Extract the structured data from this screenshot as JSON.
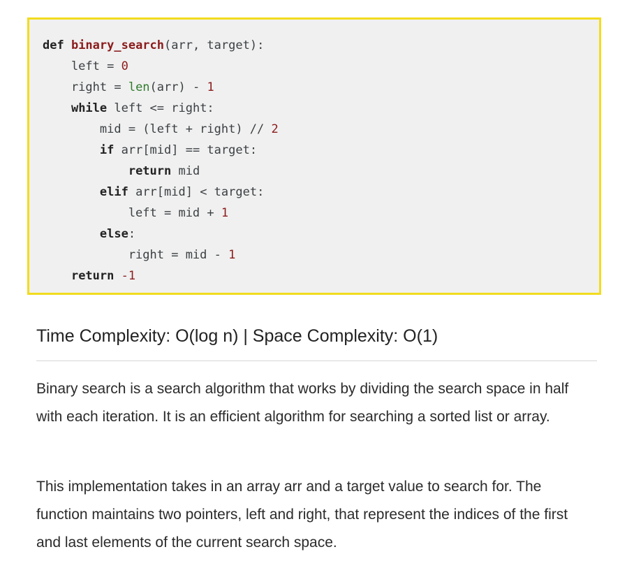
{
  "code": {
    "language": "python",
    "lines": [
      [
        {
          "t": "kw",
          "v": "def "
        },
        {
          "t": "fn",
          "v": "binary_search"
        },
        {
          "t": "p",
          "v": "(arr, target):"
        }
      ],
      [
        {
          "t": "p",
          "v": "    left = "
        },
        {
          "t": "num",
          "v": "0"
        }
      ],
      [
        {
          "t": "p",
          "v": "    right = "
        },
        {
          "t": "bi",
          "v": "len"
        },
        {
          "t": "p",
          "v": "(arr) - "
        },
        {
          "t": "num",
          "v": "1"
        }
      ],
      [
        {
          "t": "p",
          "v": "    "
        },
        {
          "t": "kw",
          "v": "while"
        },
        {
          "t": "p",
          "v": " left <= right:"
        }
      ],
      [
        {
          "t": "p",
          "v": "        mid = (left + right) // "
        },
        {
          "t": "num",
          "v": "2"
        }
      ],
      [
        {
          "t": "p",
          "v": "        "
        },
        {
          "t": "kw",
          "v": "if"
        },
        {
          "t": "p",
          "v": " arr[mid] == target:"
        }
      ],
      [
        {
          "t": "p",
          "v": "            "
        },
        {
          "t": "kw",
          "v": "return"
        },
        {
          "t": "p",
          "v": " mid"
        }
      ],
      [
        {
          "t": "p",
          "v": "        "
        },
        {
          "t": "kw",
          "v": "elif"
        },
        {
          "t": "p",
          "v": " arr[mid] < target:"
        }
      ],
      [
        {
          "t": "p",
          "v": "            left = mid + "
        },
        {
          "t": "num",
          "v": "1"
        }
      ],
      [
        {
          "t": "p",
          "v": "        "
        },
        {
          "t": "kw",
          "v": "else"
        },
        {
          "t": "p",
          "v": ":"
        }
      ],
      [
        {
          "t": "p",
          "v": "            right = mid - "
        },
        {
          "t": "num",
          "v": "1"
        }
      ],
      [
        {
          "t": "p",
          "v": "    "
        },
        {
          "t": "kw",
          "v": "return"
        },
        {
          "t": "p",
          "v": " "
        },
        {
          "t": "num",
          "v": "-1"
        }
      ]
    ]
  },
  "complexity_heading": "Time Complexity: O(log n) | Space Complexity: O(1)",
  "paragraphs": [
    "Binary search is a search algorithm that works by dividing the search space in half with each iteration. It is an efficient algorithm for searching a sorted list or array.",
    "This implementation takes in an array arr and a target value to search for. The function maintains two pointers, left and right, that represent the indices of the first and last elements of the current search space."
  ],
  "colors": {
    "code_border": "#f2dc1f",
    "code_background": "#f0f0f0",
    "function_name": "#8b1b1b",
    "number_literal": "#8b1b1b",
    "builtin": "#2f7a2b"
  }
}
